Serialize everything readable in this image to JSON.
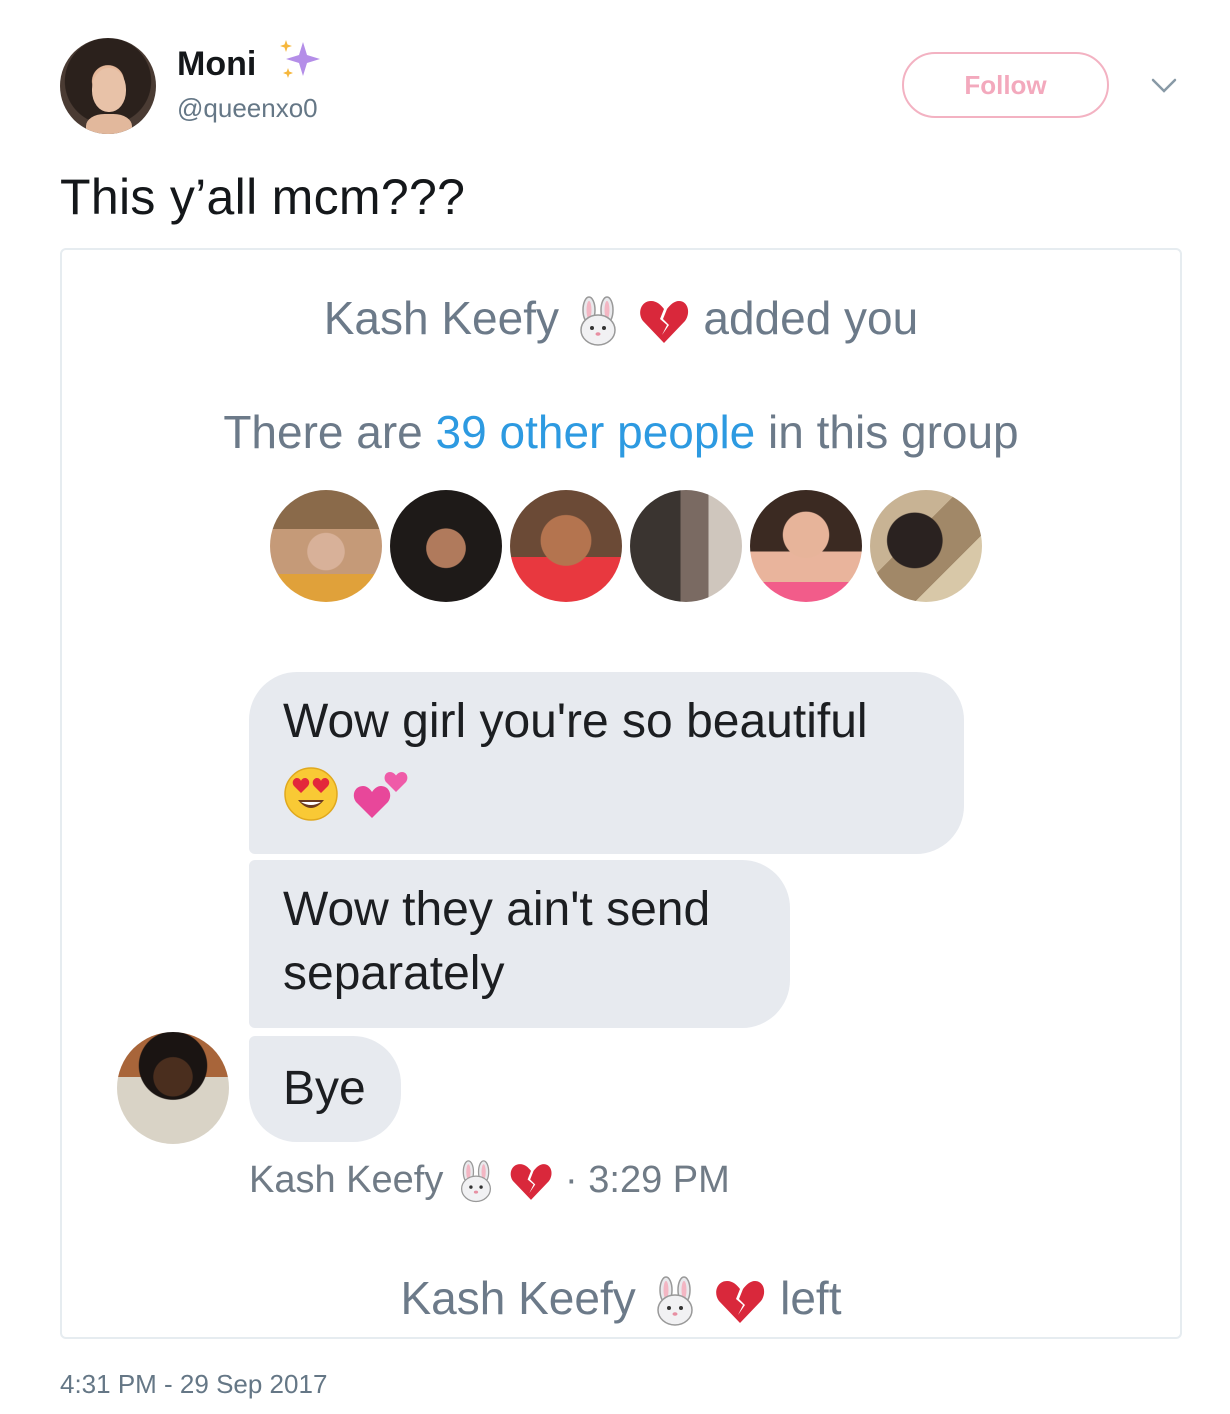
{
  "tweet": {
    "display_name": "Moni",
    "handle": "@queenxo0",
    "follow_label": "Follow",
    "text": "This y’all mcm???",
    "timestamp": "4:31 PM - 29 Sep 2017"
  },
  "screenshot": {
    "added_sender": "Kash Keefy",
    "added_suffix": "added you",
    "group_prefix": "There are",
    "group_count_link": "39 other people",
    "group_suffix": "in this group",
    "messages": [
      "Wow girl you're so beautiful",
      "Wow they ain't send separately",
      "Bye"
    ],
    "sender_name": "Kash Keefy",
    "message_time": "3:29 PM",
    "left_name": "Kash Keefy",
    "left_suffix": "left"
  },
  "icons": {
    "sparkle": "sparkle-icon",
    "chevron": "chevron-down-icon",
    "rabbit": "rabbit-face-emoji",
    "broken_heart": "broken-heart-emoji",
    "heart_eyes": "heart-eyes-emoji",
    "two_hearts": "two-hearts-emoji"
  },
  "colors": {
    "accent_link": "#2d9ae1",
    "follow_pink": "#f3a9bd",
    "bubble_gray": "#e7eaef"
  }
}
